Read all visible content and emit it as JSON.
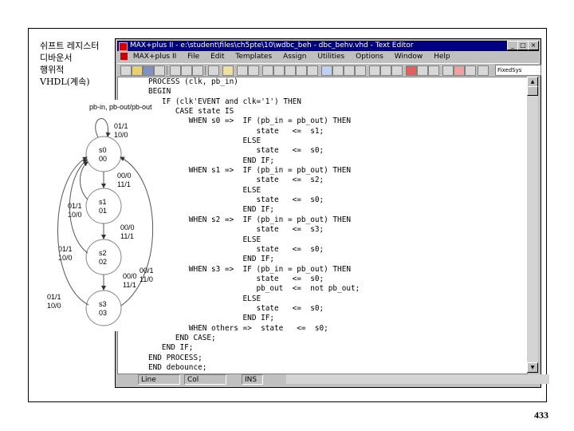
{
  "slide": {
    "title_lines": [
      "쉬프트 레지스터",
      "디바운서",
      "행위적",
      "VHDL(계속)"
    ],
    "page_number": "433"
  },
  "window": {
    "title": "MAX+plus II - e:\\student\\files\\ch5pte\\10\\wdbc_beh - dbc_behv.vhd - Text Editor",
    "menu": [
      "MAX+plus II",
      "File",
      "Edit",
      "Templates",
      "Assign",
      "Utilities",
      "Options",
      "Window",
      "Help"
    ],
    "font_combo": "FixedSys",
    "buttons": {
      "minimize": "_",
      "maximize": "□",
      "close": "×"
    },
    "status": {
      "line": "Line",
      "col": "Col",
      "mode": "INS"
    }
  },
  "code_lines": [
    "PROCESS (clk, pb_in)",
    "BEGIN",
    "   IF (clk'EVENT and clk='1') THEN",
    "      CASE state IS",
    "         WHEN s0 =>  IF (pb_in = pb_out) THEN",
    "                        state   <=  s1;",
    "                     ELSE",
    "                        state   <=  s0;",
    "                     END IF;",
    "         WHEN s1 =>  IF (pb_in = pb_out) THEN",
    "                        state   <=  s2;",
    "                     ELSE",
    "                        state   <=  s0;",
    "                     END IF;",
    "         WHEN s2 =>  IF (pb_in = pb_out) THEN",
    "                        state   <=  s3;",
    "                     ELSE",
    "                        state   <=  s0;",
    "                     END IF;",
    "         WHEN s3 =>  IF (pb_in = pb_out) THEN",
    "                        state   <=  s0;",
    "                        pb_out  <=  not pb_out;",
    "                     ELSE",
    "                        state   <=  s0;",
    "                     END IF;",
    "         WHEN others =>  state   <=  s0;",
    "      END CASE;",
    "   END IF;",
    "END PROCESS;",
    "END debounce;"
  ],
  "diagram": {
    "heading": "pb-in, pb-out/pb-out",
    "states": [
      {
        "name": "s0",
        "code": "00"
      },
      {
        "name": "s1",
        "code": "01"
      },
      {
        "name": "s2",
        "code": "02"
      },
      {
        "name": "s3",
        "code": "03"
      }
    ],
    "labels": {
      "self_loop": [
        "01/1",
        "10/0"
      ],
      "s0_s1": [
        "00/0",
        "11/1"
      ],
      "s1_s2": [
        "00/0",
        "11/1"
      ],
      "s2_s3": [
        "00/0",
        "11/1"
      ],
      "s1_back": [
        "01/1",
        "10/0"
      ],
      "s2_back": [
        "01/1",
        "10/0"
      ],
      "s3_back": [
        "01/1",
        "10/0"
      ],
      "right_back": [
        "00/1",
        "11/0"
      ]
    }
  }
}
